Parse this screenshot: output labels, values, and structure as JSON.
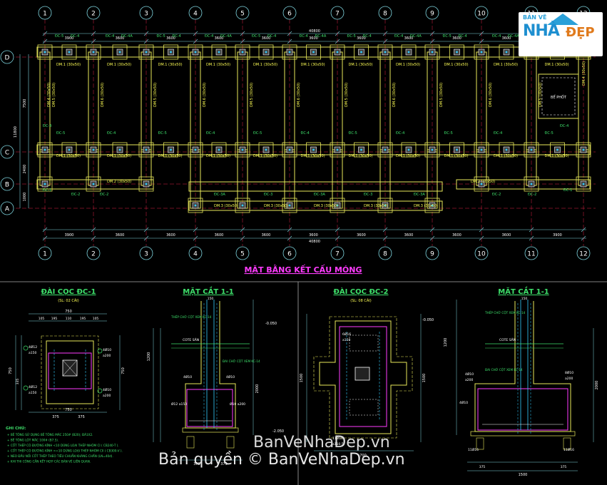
{
  "grid": {
    "top_labels": [
      "1",
      "2",
      "3",
      "4",
      "5",
      "6",
      "7",
      "8",
      "9",
      "10",
      "11",
      "12"
    ],
    "row_labels": [
      "D",
      "C",
      "B",
      "A"
    ],
    "overall_dim": "40800",
    "span_dims": [
      "3900",
      "3600",
      "3600",
      "3600",
      "3600",
      "3600",
      "3600",
      "3600",
      "3600",
      "3600",
      "3900"
    ],
    "row_dims": [
      "7500",
      "2400",
      "1000"
    ],
    "total_height": "11800"
  },
  "plan": {
    "title": "MẶT BẰNG KẾT CẤU MÓNG",
    "labels": {
      "dc1": "ĐC-1",
      "dc2": "ĐC-2",
      "dc3": "ĐC-3",
      "dc3a": "ĐC-3A",
      "dc4": "ĐC-4",
      "dc4a": "ĐC-4A",
      "dc5": "ĐC-5",
      "dm1": "DM.1 (30x50)",
      "dm2": "DM.2 (30x50)",
      "dm3": "DM.3 (30x50)",
      "dm4": "DM.4 (30x50)",
      "dm5": "DM.5 (30x50)",
      "dm6": "DM.6 (30x50)",
      "be_phot": "BỂ PHỐT"
    }
  },
  "details": {
    "dc1_title": "ĐÀI CỌC ĐC-1",
    "dc1_sub": "(SL: 02 CÁI)",
    "s11a_title": "MẶT CẮT 1-1",
    "dc2_title": "ĐÀI CỌC ĐC-2",
    "dc2_sub": "(SL: 08 CÁI)",
    "s11b_title": "MẶT CẮT 1-1",
    "dims": {
      "d750": "750",
      "d105": "105",
      "d195": "195",
      "d110": "110",
      "d375": "375",
      "d335": "335",
      "d150": "150",
      "d1200": "1200",
      "d2000": "2000",
      "d1500": "1500",
      "d700": "700",
      "d130": "130",
      "d190": "190",
      "m050": "-0.050",
      "m2050": "-2.050"
    },
    "rebars": {
      "r4012": "4Ø12",
      "r1": "4Ø10",
      "r2": "8Ø10",
      "r3": "6Ø16",
      "a150": "a150",
      "a200": "a200",
      "r1116": "11Ø16",
      "a1105": "a110.5",
      "tie": "THÉP CHỜ CỘT XEM KC-14",
      "cote": "COTE SÂN",
      "daichio": "ĐAI CHỜ CỘT XEM KC-14",
      "d12a150": "Ø12 a150",
      "d10a200": "Ø10 a200"
    },
    "notes_title": "GHI CHÚ:",
    "notes": [
      "+ BÊ TÔNG   SỬ DỤNG BÊ TÔNG MÁC 250# (B20); ĐÁ1X2.",
      "+ BÊ TÔNG LÓT MÁC 100# (B7.5).",
      "+ CỐT THÉP CÓ ĐƯỜNG KÍNH <10 DÙNG LOẠI THÉP NHÓM CI ( CB240-T ).",
      "+ CỐT THÉP CÓ ĐƯỜNG KÍNH >=10 DÙNG LOẠI THÉP NHÓM CII ( CB300-V ).",
      "+ NEO ĐẦU NỐI CỐT THÉP THEO TIÊU CHUẨN KHÁNG CHẤN (LN=40d).",
      "+ KHI THI CÔNG CẦN KẾT HỢP CÁC BẢN VẼ LIÊN QUAN."
    ]
  },
  "logo": {
    "line1": "BẢN VẼ",
    "line2": "NHÀ",
    "line3": "ĐẸP"
  },
  "watermark": {
    "line1": "BanVeNhaDep.vn",
    "line2": "Bản quyền © BanVeNhaDep.vn"
  }
}
